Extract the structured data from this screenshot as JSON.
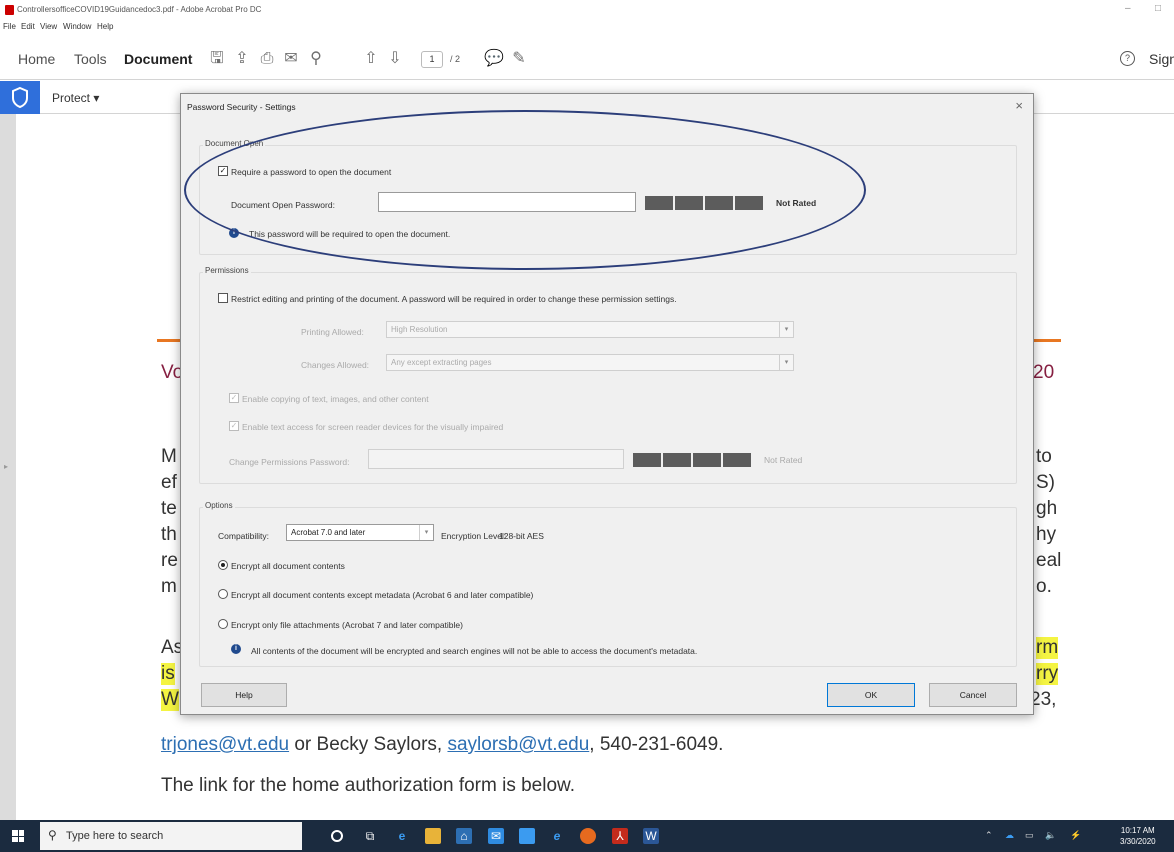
{
  "window": {
    "title": "ControllersofficeCOVID19Guidancedoc3.pdf - Adobe Acrobat Pro DC",
    "restore_glyph": "–",
    "maximize_glyph": "□"
  },
  "menu": [
    "File",
    "Edit",
    "View",
    "Window",
    "Help"
  ],
  "toolbar": {
    "tabs": [
      "Home",
      "Tools",
      "Document"
    ],
    "active_tab": "Document",
    "page_current": "1",
    "page_total": "/ 2",
    "sign_label": "Sign"
  },
  "protect": {
    "label": "Protect ▾"
  },
  "document": {
    "heading_left": "Vo",
    "heading_right": "20",
    "para_left": [
      "M",
      "ef",
      "te",
      "th",
      "re",
      "m"
    ],
    "para_right": [
      "to",
      "S)",
      "gh",
      "hy",
      "eal",
      "o."
    ],
    "as_left": [
      "As",
      "is",
      "W"
    ],
    "as_right": [
      "rm",
      "rry",
      "23,"
    ],
    "contact_email1": "trjones@vt.edu",
    "contact_mid": " or Becky Saylors, ",
    "contact_email2": "saylorsb@vt.edu",
    "contact_tail": ", 540-231-6049.",
    "link_line": "The link for the home authorization form is below."
  },
  "dialog": {
    "title": "Password Security - Settings",
    "close": "×",
    "open_group": {
      "label": "Document Open",
      "require_checkbox": "Require a password to open the document",
      "require_checked": true,
      "password_label": "Document Open Password:",
      "password_value": "",
      "rating": "Not Rated",
      "info": "This password will be required to open the document."
    },
    "permissions_group": {
      "label": "Permissions",
      "restrict_checkbox": "Restrict editing and printing of the document. A password will be required in order to change these permission settings.",
      "restrict_checked": false,
      "printing_label": "Printing Allowed:",
      "printing_value": "High Resolution",
      "changes_label": "Changes Allowed:",
      "changes_value": "Any except extracting pages",
      "copy_checkbox": "Enable copying of text, images, and other content",
      "screen_reader_checkbox": "Enable text access for screen reader devices for the visually impaired",
      "perm_password_label": "Change Permissions Password:",
      "rating": "Not Rated"
    },
    "options_group": {
      "label": "Options",
      "compat_label": "Compatibility:",
      "compat_value": "Acrobat 7.0 and later",
      "encryption_label": "Encryption Level:",
      "encryption_value": "128-bit AES",
      "radio_all": "Encrypt all document contents",
      "radio_except_meta": "Encrypt all document contents except metadata (Acrobat 6 and later compatible)",
      "radio_attachments": "Encrypt only file attachments (Acrobat 7 and later compatible)",
      "selected_radio": "radio_all",
      "info": "All contents of the document will be encrypted and search engines will not be able to access the document's metadata."
    },
    "buttons": {
      "help": "Help",
      "ok": "OK",
      "cancel": "Cancel"
    }
  },
  "taskbar": {
    "search_placeholder": "Type here to search",
    "time": "10:17 AM",
    "date": "3/30/2020"
  },
  "colors": {
    "accent_orange": "#e87722",
    "maroon": "#861f41",
    "highlight": "#f4f442",
    "annotation": "#2c3e7a",
    "protect_blue": "#2f6fdb"
  }
}
